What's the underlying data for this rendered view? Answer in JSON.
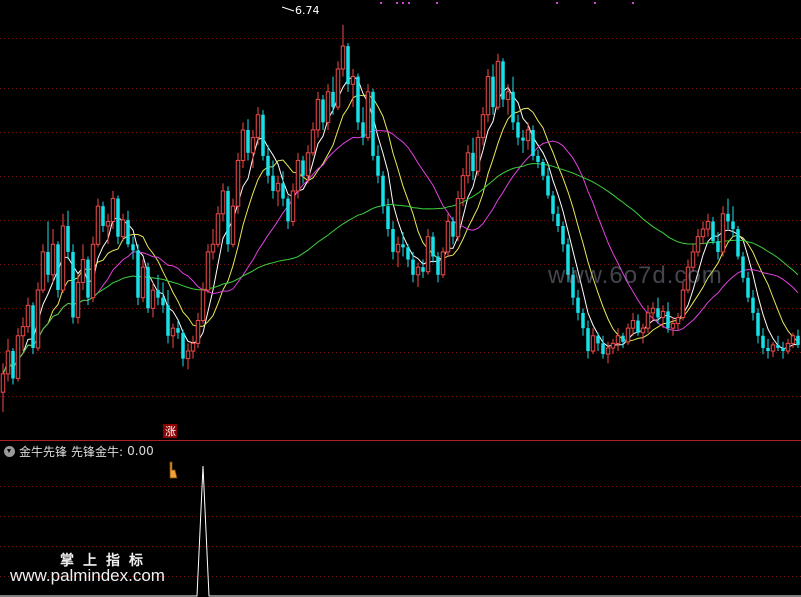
{
  "chart_data": [
    {
      "type": "candlestick",
      "panel": "main",
      "title": "",
      "ylim": [
        4.2,
        6.85
      ],
      "high_annotation": {
        "label": "6.74",
        "x_index": 68
      },
      "up_marker": {
        "label": "涨",
        "x_index": 40
      },
      "colors": {
        "up": "#f04a4a",
        "down": "#18e0e8",
        "ma5": "#ffffff",
        "ma10": "#e8e85a",
        "ma20": "#e040e0",
        "ma60": "#3cd23c"
      },
      "ohlc": [
        [
          4.33,
          4.52,
          4.2,
          4.45
        ],
        [
          4.45,
          4.68,
          4.4,
          4.6
        ],
        [
          4.6,
          4.62,
          4.38,
          4.42
        ],
        [
          4.42,
          4.75,
          4.4,
          4.7
        ],
        [
          4.7,
          4.82,
          4.6,
          4.76
        ],
        [
          4.76,
          4.95,
          4.72,
          4.9
        ],
        [
          4.9,
          4.92,
          4.58,
          4.62
        ],
        [
          4.62,
          5.05,
          4.6,
          5.0
        ],
        [
          5.0,
          5.3,
          4.98,
          5.25
        ],
        [
          5.25,
          5.45,
          5.05,
          5.1
        ],
        [
          5.1,
          5.4,
          5.05,
          5.3
        ],
        [
          5.3,
          5.32,
          4.95,
          5.0
        ],
        [
          5.0,
          5.5,
          4.98,
          5.42
        ],
        [
          5.42,
          5.52,
          5.2,
          5.25
        ],
        [
          5.25,
          5.3,
          4.78,
          4.82
        ],
        [
          4.82,
          5.1,
          4.78,
          5.05
        ],
        [
          5.05,
          5.3,
          5.0,
          5.2
        ],
        [
          5.2,
          5.22,
          4.9,
          4.95
        ],
        [
          4.95,
          5.35,
          4.92,
          5.3
        ],
        [
          5.3,
          5.6,
          5.28,
          5.55
        ],
        [
          5.55,
          5.58,
          5.38,
          5.42
        ],
        [
          5.42,
          5.5,
          5.3,
          5.45
        ],
        [
          5.45,
          5.65,
          5.4,
          5.6
        ],
        [
          5.6,
          5.62,
          5.3,
          5.35
        ],
        [
          5.35,
          5.5,
          5.32,
          5.46
        ],
        [
          5.46,
          5.52,
          5.28,
          5.3
        ],
        [
          5.3,
          5.35,
          5.2,
          5.26
        ],
        [
          5.26,
          5.3,
          4.9,
          4.95
        ],
        [
          4.95,
          5.2,
          4.92,
          5.15
        ],
        [
          5.15,
          5.18,
          4.85,
          4.88
        ],
        [
          4.88,
          5.05,
          4.82,
          5.0
        ],
        [
          5.0,
          5.1,
          4.9,
          4.95
        ],
        [
          4.95,
          5.05,
          4.85,
          4.9
        ],
        [
          4.9,
          5.0,
          4.65,
          4.7
        ],
        [
          4.7,
          4.78,
          4.62,
          4.75
        ],
        [
          4.75,
          4.8,
          4.68,
          4.72
        ],
        [
          4.72,
          4.74,
          4.5,
          4.55
        ],
        [
          4.55,
          4.65,
          4.48,
          4.6
        ],
        [
          4.6,
          4.7,
          4.55,
          4.65
        ],
        [
          4.65,
          4.85,
          4.62,
          4.8
        ],
        [
          4.8,
          5.05,
          4.78,
          5.0
        ],
        [
          5.0,
          5.3,
          4.98,
          5.25
        ],
        [
          5.25,
          5.4,
          5.2,
          5.3
        ],
        [
          5.3,
          5.55,
          5.28,
          5.5
        ],
        [
          5.5,
          5.7,
          5.45,
          5.65
        ],
        [
          5.65,
          5.68,
          5.25,
          5.3
        ],
        [
          5.3,
          5.6,
          5.28,
          5.55
        ],
        [
          5.55,
          5.9,
          5.5,
          5.85
        ],
        [
          5.85,
          6.1,
          5.8,
          6.05
        ],
        [
          6.05,
          6.12,
          5.85,
          5.9
        ],
        [
          5.9,
          6.05,
          5.8,
          6.0
        ],
        [
          6.0,
          6.2,
          5.95,
          6.15
        ],
        [
          6.15,
          6.18,
          5.85,
          5.88
        ],
        [
          5.88,
          5.95,
          5.7,
          5.75
        ],
        [
          5.75,
          5.85,
          5.6,
          5.65
        ],
        [
          5.65,
          5.75,
          5.55,
          5.7
        ],
        [
          5.7,
          5.78,
          5.55,
          5.6
        ],
        [
          5.6,
          5.62,
          5.4,
          5.45
        ],
        [
          5.45,
          5.7,
          5.42,
          5.65
        ],
        [
          5.65,
          5.9,
          5.6,
          5.85
        ],
        [
          5.85,
          5.88,
          5.7,
          5.75
        ],
        [
          5.75,
          5.95,
          5.7,
          5.9
        ],
        [
          5.9,
          6.1,
          5.88,
          6.05
        ],
        [
          6.05,
          6.3,
          6.0,
          6.25
        ],
        [
          6.25,
          6.28,
          6.05,
          6.1
        ],
        [
          6.1,
          6.35,
          6.05,
          6.3
        ],
        [
          6.3,
          6.4,
          6.15,
          6.2
        ],
        [
          6.2,
          6.5,
          6.18,
          6.45
        ],
        [
          6.45,
          6.74,
          6.4,
          6.6
        ],
        [
          6.6,
          6.62,
          6.3,
          6.35
        ],
        [
          6.35,
          6.45,
          6.2,
          6.4
        ],
        [
          6.4,
          6.42,
          6.05,
          6.1
        ],
        [
          6.1,
          6.2,
          5.95,
          6.0
        ],
        [
          6.0,
          6.35,
          5.98,
          6.3
        ],
        [
          6.3,
          6.32,
          5.85,
          5.88
        ],
        [
          5.88,
          5.95,
          5.7,
          5.75
        ],
        [
          5.75,
          5.78,
          5.5,
          5.55
        ],
        [
          5.55,
          5.6,
          5.35,
          5.4
        ],
        [
          5.4,
          5.45,
          5.2,
          5.25
        ],
        [
          5.25,
          5.35,
          5.15,
          5.3
        ],
        [
          5.3,
          5.38,
          5.22,
          5.28
        ],
        [
          5.28,
          5.3,
          5.15,
          5.2
        ],
        [
          5.2,
          5.25,
          5.05,
          5.1
        ],
        [
          5.1,
          5.18,
          5.02,
          5.15
        ],
        [
          5.15,
          5.2,
          5.08,
          5.12
        ],
        [
          5.12,
          5.4,
          5.1,
          5.35
        ],
        [
          5.35,
          5.38,
          5.18,
          5.22
        ],
        [
          5.22,
          5.25,
          5.05,
          5.1
        ],
        [
          5.1,
          5.28,
          5.08,
          5.25
        ],
        [
          5.25,
          5.5,
          5.22,
          5.45
        ],
        [
          5.45,
          5.48,
          5.3,
          5.35
        ],
        [
          5.35,
          5.65,
          5.32,
          5.6
        ],
        [
          5.6,
          5.8,
          5.55,
          5.75
        ],
        [
          5.75,
          5.95,
          5.7,
          5.9
        ],
        [
          5.9,
          6.0,
          5.72,
          5.78
        ],
        [
          5.78,
          6.05,
          5.75,
          6.0
        ],
        [
          6.0,
          6.2,
          5.95,
          6.15
        ],
        [
          6.15,
          6.45,
          6.1,
          6.4
        ],
        [
          6.4,
          6.48,
          6.15,
          6.2
        ],
        [
          6.2,
          6.55,
          6.18,
          6.5
        ],
        [
          6.5,
          6.52,
          6.2,
          6.25
        ],
        [
          6.25,
          6.35,
          6.15,
          6.3
        ],
        [
          6.3,
          6.4,
          6.05,
          6.1
        ],
        [
          6.1,
          6.15,
          5.95,
          6.0
        ],
        [
          6.0,
          6.05,
          5.9,
          5.98
        ],
        [
          5.98,
          6.1,
          5.92,
          6.05
        ],
        [
          6.05,
          6.08,
          5.85,
          5.88
        ],
        [
          5.88,
          5.92,
          5.8,
          5.84
        ],
        [
          5.84,
          5.86,
          5.72,
          5.75
        ],
        [
          5.75,
          5.8,
          5.6,
          5.62
        ],
        [
          5.62,
          5.65,
          5.45,
          5.5
        ],
        [
          5.5,
          5.55,
          5.38,
          5.42
        ],
        [
          5.42,
          5.45,
          5.25,
          5.3
        ],
        [
          5.3,
          5.34,
          5.05,
          5.1
        ],
        [
          5.1,
          5.15,
          4.9,
          4.95
        ],
        [
          4.95,
          5.0,
          4.8,
          4.85
        ],
        [
          4.85,
          4.88,
          4.7,
          4.75
        ],
        [
          4.75,
          4.8,
          4.55,
          4.6
        ],
        [
          4.6,
          4.75,
          4.58,
          4.7
        ],
        [
          4.7,
          4.72,
          4.6,
          4.65
        ],
        [
          4.65,
          4.7,
          4.55,
          4.58
        ],
        [
          4.58,
          4.66,
          4.52,
          4.62
        ],
        [
          4.62,
          4.68,
          4.58,
          4.65
        ],
        [
          4.65,
          4.75,
          4.6,
          4.7
        ],
        [
          4.7,
          4.72,
          4.62,
          4.66
        ],
        [
          4.66,
          4.78,
          4.64,
          4.75
        ],
        [
          4.75,
          4.85,
          4.7,
          4.8
        ],
        [
          4.8,
          4.84,
          4.7,
          4.72
        ],
        [
          4.72,
          4.78,
          4.65,
          4.75
        ],
        [
          4.75,
          4.9,
          4.72,
          4.85
        ],
        [
          4.85,
          4.92,
          4.8,
          4.88
        ],
        [
          4.88,
          4.95,
          4.78,
          4.82
        ],
        [
          4.82,
          4.9,
          4.75,
          4.86
        ],
        [
          4.86,
          4.92,
          4.72,
          4.75
        ],
        [
          4.75,
          4.82,
          4.7,
          4.78
        ],
        [
          4.78,
          4.85,
          4.74,
          4.82
        ],
        [
          4.82,
          5.05,
          4.8,
          5.0
        ],
        [
          5.0,
          5.2,
          4.98,
          5.15
        ],
        [
          5.15,
          5.3,
          5.12,
          5.25
        ],
        [
          5.25,
          5.4,
          5.22,
          5.35
        ],
        [
          5.35,
          5.45,
          5.3,
          5.4
        ],
        [
          5.4,
          5.5,
          5.35,
          5.45
        ],
        [
          5.45,
          5.48,
          5.3,
          5.32
        ],
        [
          5.32,
          5.38,
          5.2,
          5.25
        ],
        [
          5.25,
          5.55,
          5.22,
          5.5
        ],
        [
          5.5,
          5.6,
          5.4,
          5.45
        ],
        [
          5.45,
          5.55,
          5.35,
          5.4
        ],
        [
          5.4,
          5.42,
          5.2,
          5.22
        ],
        [
          5.22,
          5.25,
          5.05,
          5.08
        ],
        [
          5.08,
          5.12,
          4.92,
          4.95
        ],
        [
          4.95,
          5.0,
          4.8,
          4.85
        ],
        [
          4.85,
          4.88,
          4.65,
          4.7
        ],
        [
          4.7,
          4.75,
          4.58,
          4.62
        ],
        [
          4.62,
          4.68,
          4.55,
          4.6
        ],
        [
          4.6,
          4.66,
          4.56,
          4.64
        ],
        [
          4.64,
          4.7,
          4.6,
          4.62
        ],
        [
          4.62,
          4.66,
          4.55,
          4.6
        ],
        [
          4.6,
          4.68,
          4.58,
          4.65
        ],
        [
          4.65,
          4.72,
          4.62,
          4.7
        ],
        [
          4.7,
          4.74,
          4.62,
          4.64
        ]
      ]
    },
    {
      "type": "line",
      "panel": "indicator",
      "name": "金牛先锋",
      "series_label": "先锋金牛",
      "value_label": "0.00",
      "ylim": [
        0,
        1
      ],
      "spike_index": 40,
      "values_note": "zero except a single spike"
    }
  ],
  "indicator": {
    "title": "金牛先锋",
    "line_label": "先锋金牛:",
    "value": "0.00"
  },
  "watermark": {
    "subtitle": "掌上指标",
    "url": "www.palmindex.com",
    "mid": "www.6o7d.com"
  },
  "icons": {
    "toggle": "chevron-circle-icon",
    "cursor": "hand-pointer-icon"
  }
}
